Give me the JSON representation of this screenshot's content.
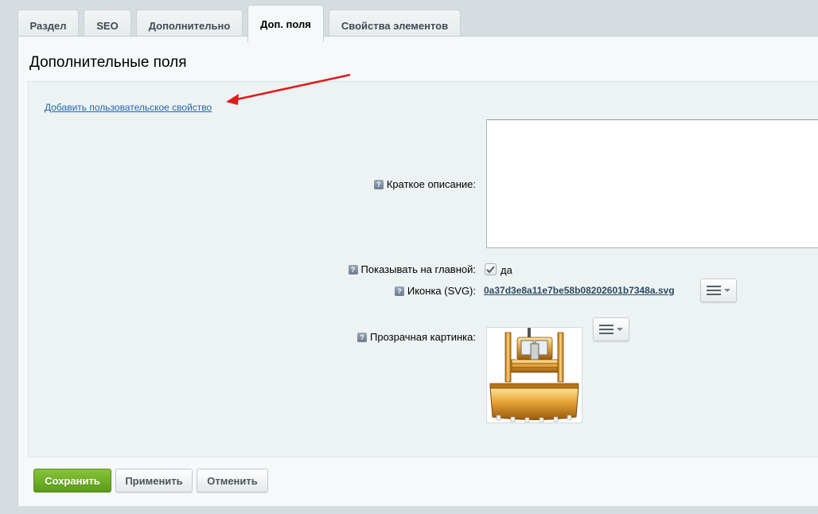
{
  "tabs": [
    {
      "label": "Раздел"
    },
    {
      "label": "SEO"
    },
    {
      "label": "Дополнительно"
    },
    {
      "label": "Доп. поля",
      "active": true
    },
    {
      "label": "Свойства элементов"
    }
  ],
  "panel": {
    "title": "Дополнительные поля",
    "add_property_link": "Добавить пользовательское свойство"
  },
  "fields": {
    "short_description": {
      "label": "Краткое описание:",
      "value": ""
    },
    "show_on_main": {
      "label": "Показывать на главной:",
      "checked": true,
      "option_text": "да"
    },
    "icon_svg": {
      "label": "Иконка (SVG):",
      "file_name": "0a37d3e8a11e7be58b08202601b7348a.svg"
    },
    "transparent_image": {
      "label": "Прозрачная картинка:"
    }
  },
  "help_icon_glyph": "?",
  "buttons": {
    "save": "Сохранить",
    "apply": "Применить",
    "cancel": "Отменить"
  },
  "colors": {
    "accent_green": "#6aaa22",
    "link_blue": "#2067b0",
    "annotation_arrow": "#e01b1b"
  },
  "icons": [
    "help-icon",
    "menu-icon",
    "checkmark-icon",
    "bulldozer-image"
  ]
}
